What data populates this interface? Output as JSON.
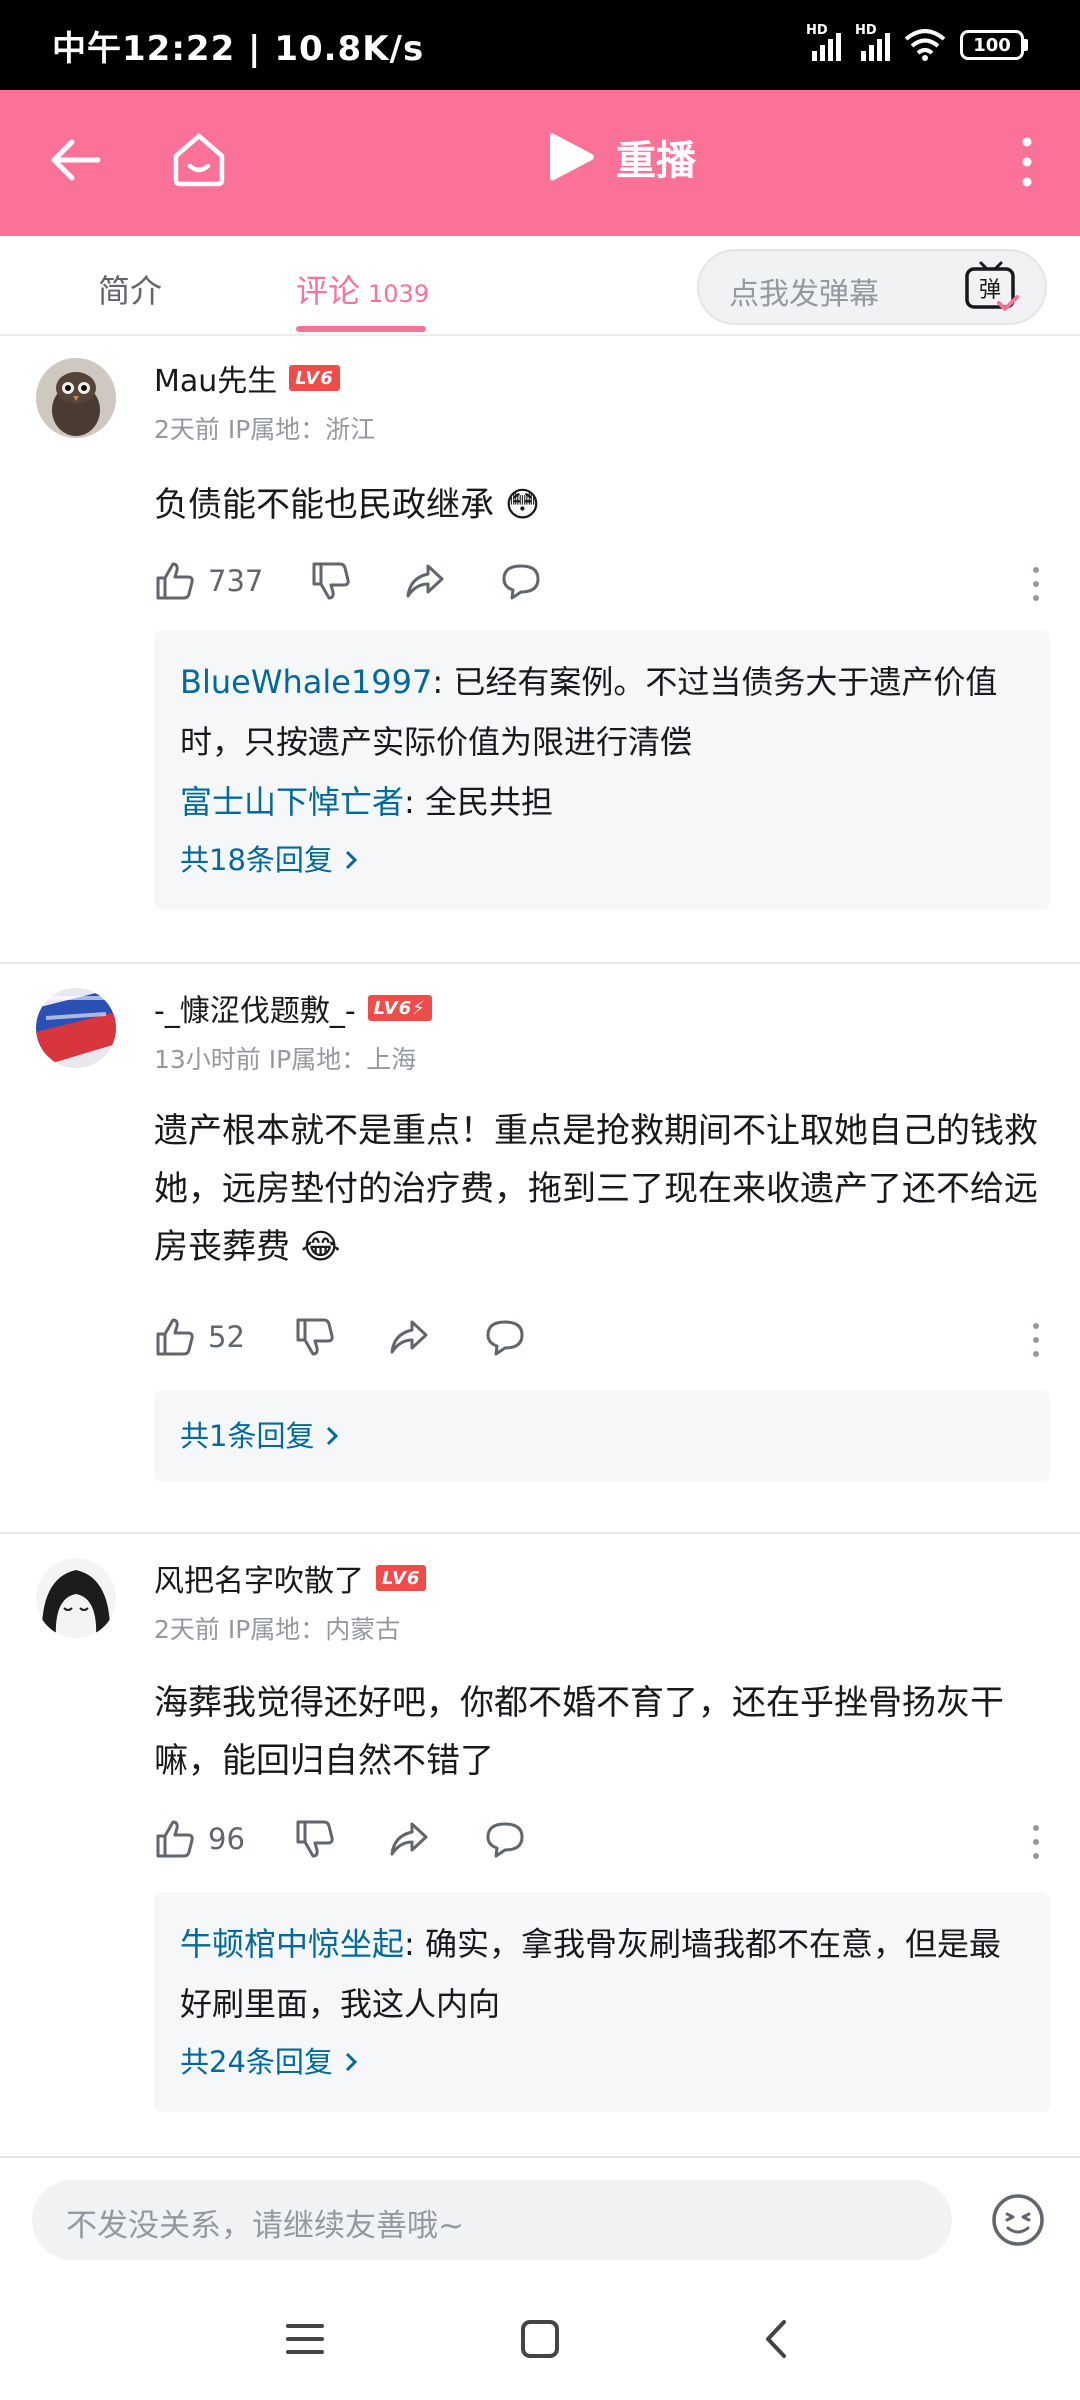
{
  "status_bar": {
    "time": "中午12:22 | 10.8K/s",
    "sim1": "HD",
    "sim2": "HD",
    "battery": "100"
  },
  "top_bar": {
    "title": "重播"
  },
  "tabs": {
    "intro": "简介",
    "comments": "评论",
    "comments_count": "1039",
    "danmaku_placeholder": "点我发弹幕",
    "danmaku_icon_label": "弹"
  },
  "comments": [
    {
      "username": "Mau先生",
      "level": "LV6",
      "meta": "2天前 IP属地：浙江",
      "text": "负债能不能也民政继承 😳",
      "likes": "737",
      "replies": [
        {
          "name": "BlueWhale1997",
          "text": ": 已经有案例。不过当债务大于遗产价值时，只按遗产实际价值为限进行清偿"
        },
        {
          "name": "富士山下悼亡者",
          "text": ": 全民共担"
        }
      ],
      "reply_total": "共18条回复"
    },
    {
      "username": "-_慷涩伐题敷_-",
      "level": "LV6⚡",
      "meta": "13小时前 IP属地：上海",
      "text": "遗产根本就不是重点！重点是抢救期间不让取她自己的钱救她，远房垫付的治疗费，拖到三了现在来收遗产了还不给远房丧葬费 😂",
      "likes": "52",
      "replies": [],
      "reply_total": "共1条回复"
    },
    {
      "username": "风把名字吹散了",
      "level": "LV6",
      "meta": "2天前 IP属地：内蒙古",
      "text": "海葬我觉得还好吧，你都不婚不育了，还在乎挫骨扬灰干嘛，能回归自然不错了",
      "likes": "96",
      "replies": [
        {
          "name": "牛顿棺中惊坐起",
          "text": ": 确实，拿我骨灰刷墙我都不在意，但是最好刷里面，我这人内向"
        }
      ],
      "reply_total": "共24条回复"
    }
  ],
  "input_bar": {
    "placeholder": "不发没关系，请继续友善哦~"
  }
}
